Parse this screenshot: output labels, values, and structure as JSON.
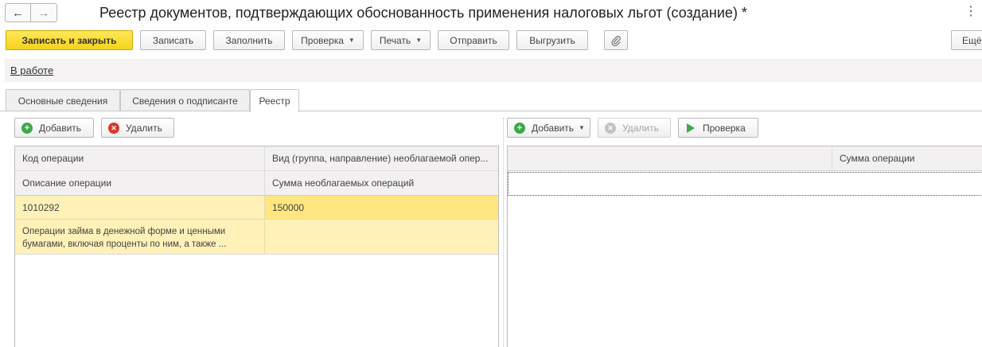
{
  "window": {
    "title": "Реестр документов, подтверждающих обоснованность применения налоговых льгот (создание) *",
    "back_icon": "←",
    "forward_icon": "→",
    "more_icon": "⋮"
  },
  "toolbar": {
    "save_close": "Записать и закрыть",
    "save": "Записать",
    "fill": "Заполнить",
    "check": "Проверка",
    "print": "Печать",
    "send": "Отправить",
    "export": "Выгрузить",
    "attach_icon": "paperclip-icon",
    "more": "Ещё"
  },
  "state": {
    "link": "В работе"
  },
  "tabs": [
    {
      "label": "Основные сведения",
      "active": false
    },
    {
      "label": "Сведения о подписанте",
      "active": false
    },
    {
      "label": "Реестр",
      "active": true
    }
  ],
  "left_panel": {
    "add": "Добавить",
    "delete": "Удалить",
    "columns": {
      "code": "Код операции",
      "kind": "Вид (группа, направление) необлагаемой опер...",
      "description": "Описание операции",
      "sum": "Сумма необлагаемых операций"
    },
    "rows": [
      {
        "code": "1010292",
        "kind": "",
        "description_line1": "Операции займа в денежной форме и ценными",
        "description_line2": "бумагами, включая проценты по ним, а также ...",
        "sum": "150000"
      }
    ]
  },
  "right_panel": {
    "add": "Добавить",
    "delete": "Удалить",
    "check": "Проверка",
    "columns": {
      "first": "",
      "sum": "Сумма операции"
    }
  },
  "colors": {
    "primary_button": "#f5d21b",
    "selected_row": "#fff1b8",
    "selected_cell": "#ffe680",
    "header_bg": "#f2f0f0",
    "add_icon": "#3da94b",
    "delete_icon": "#d9362b"
  }
}
